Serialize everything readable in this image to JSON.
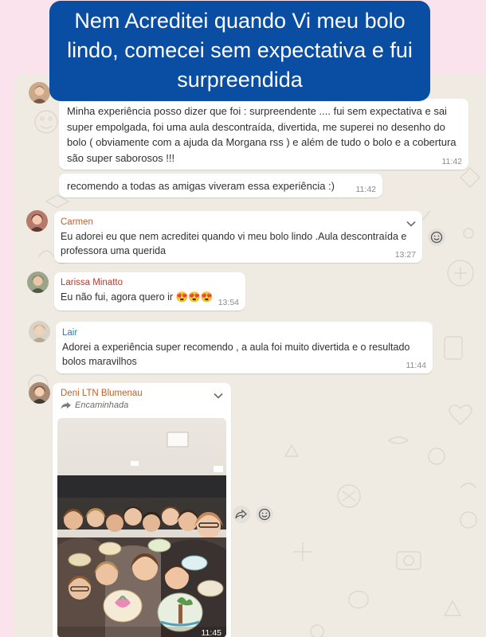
{
  "banner": {
    "text": "Nem Acreditei quando Vi meu bolo lindo, comecei sem expectativa e fui surpreendida"
  },
  "messages": [
    {
      "text": "Minha experiência posso dizer que foi : surpreendente .... fui sem expectativa e sai super empolgada, foi uma aula descontraída, divertida, me superei no desenho do bolo ( obviamente com a ajuda da Morgana rss ) e além de tudo o bolo e a cobertura são super saborosos !!!",
      "time": "11:42"
    },
    {
      "text": "recomendo a todas as amigas  viveram essa experiência :)",
      "time": "11:42"
    },
    {
      "sender": "Carmen",
      "sender_color": "#c0602a",
      "text": "Eu adorei eu que nem acreditei quando vi meu bolo  lindo .Aula descontraída e professora uma querida",
      "time": "13:27"
    },
    {
      "sender": "Larissa Minatto",
      "sender_color": "#c0392b",
      "text": "Eu não fui, agora quero ir 😍😍😍",
      "time": "13:54"
    },
    {
      "sender": "Lair",
      "sender_color": "#2a7ab8",
      "text": "Adorei a experiência super recomendo , a aula foi muito divertida e o resultado bolos maravilhos",
      "time": "11:44"
    },
    {
      "sender": "Deni LTN Blumenau",
      "sender_color": "#c0602a",
      "forwarded_label": "Encaminhada",
      "time": "11:45"
    }
  ],
  "icons": {
    "chevron": "chevron-down-icon",
    "emoji": "emoji-react-icon",
    "forward": "forward-icon"
  }
}
